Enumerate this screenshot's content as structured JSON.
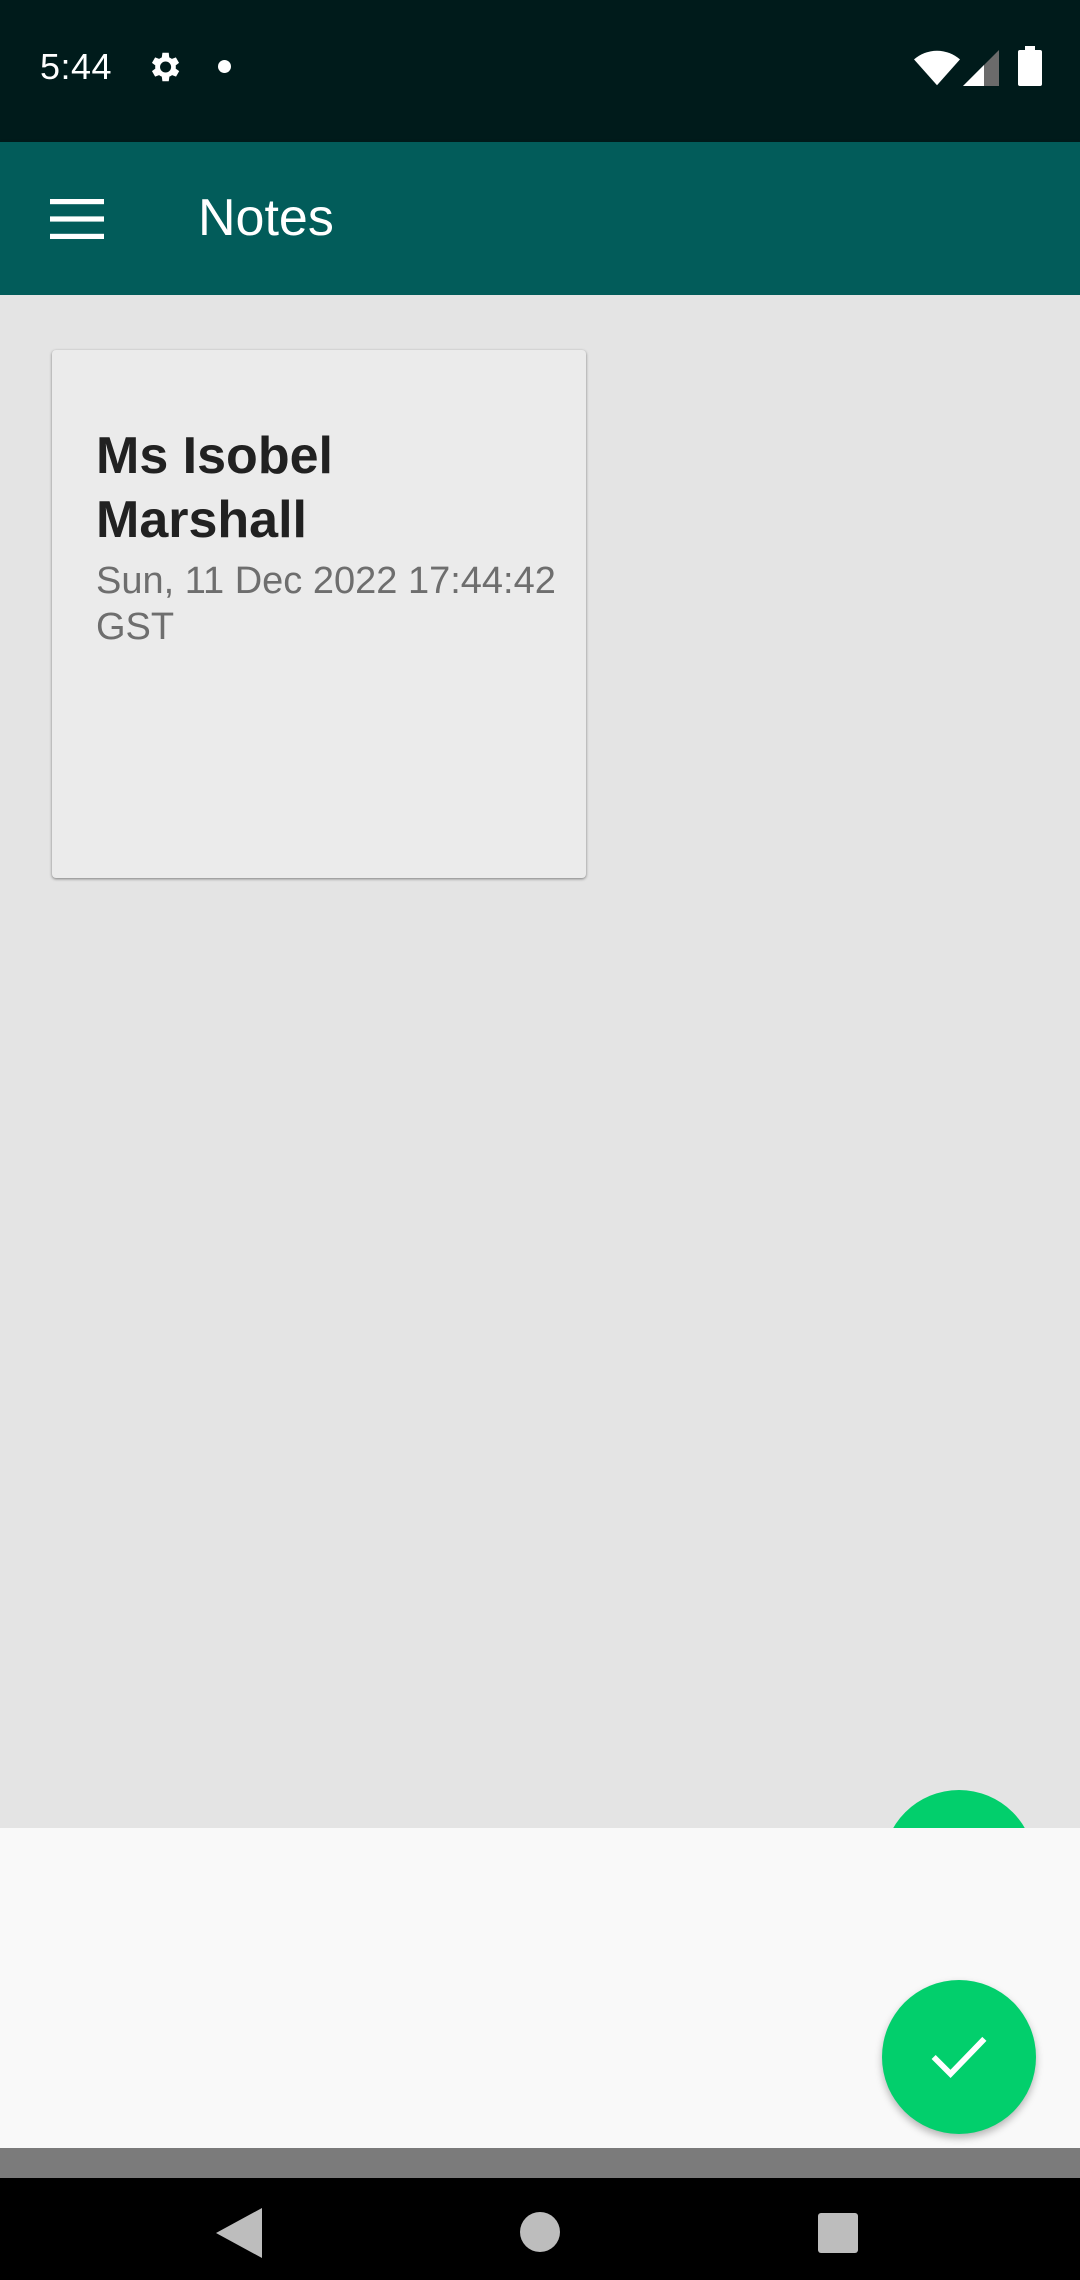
{
  "status_bar": {
    "time": "5:44",
    "icons": [
      "gear-icon",
      "notification-dot-icon",
      "wifi-icon",
      "signal-icon",
      "battery-icon"
    ]
  },
  "app_bar": {
    "title": "Notes",
    "menu_icon": "hamburger-menu-icon"
  },
  "notes": [
    {
      "title": "Ms Isobel Marshall",
      "date": "Sun, 11 Dec 2022 17:44:42 GST"
    }
  ],
  "fab": {
    "icon": "checkmark-icon"
  },
  "nav_bar": {
    "icons": [
      "back-icon",
      "home-icon",
      "recents-icon"
    ]
  },
  "colors": {
    "status_bar": "#001b1b",
    "app_bar": "#025c5a",
    "background": "#e4e4e4",
    "card": "#ebebeb",
    "fab": "#02cf6c",
    "bottom_sheet": "#f9f9f9"
  }
}
